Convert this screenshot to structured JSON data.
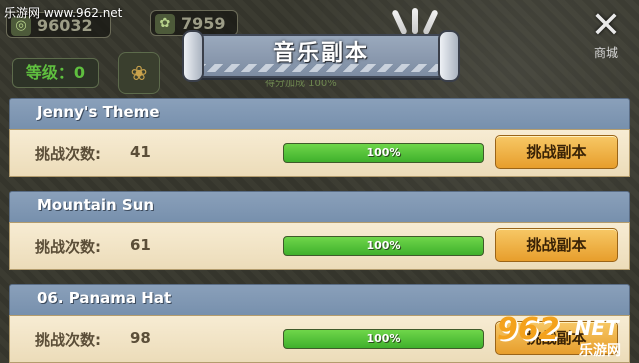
{
  "watermark": "乐游网 www.962.net",
  "top": {
    "resource1": "96032",
    "resource2": "7959",
    "level_label": "等级：0",
    "dim_text": "得分加成 100%"
  },
  "banner": {
    "title": "音乐副本"
  },
  "close": {
    "label": "商城",
    "icon": "close-x-icon"
  },
  "rows": [
    {
      "title": "Jenny's Theme",
      "count_label": "挑战次数:",
      "count": "41",
      "progress": 1.0,
      "progress_text": "100%",
      "button": "挑战副本"
    },
    {
      "title": "Mountain Sun",
      "count_label": "挑战次数:",
      "count": "61",
      "progress": 1.0,
      "progress_text": "100%",
      "button": "挑战副本"
    },
    {
      "title": "06. Panama Hat",
      "count_label": "挑战次数:",
      "count": "98",
      "progress": 1.0,
      "progress_text": "100%",
      "button": "挑战副本"
    }
  ],
  "logo": {
    "brand": "962",
    "suffix": ".NET",
    "cn": "乐游网"
  },
  "colors": {
    "accent": "#f0b24a",
    "progress": "#56c83a",
    "header": "#8aa0ba"
  }
}
